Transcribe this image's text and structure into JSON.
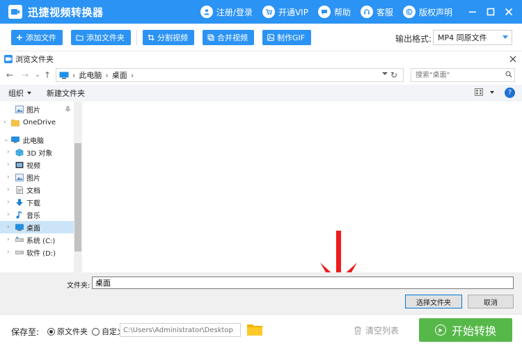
{
  "app": {
    "title": "迅捷视频转换器",
    "links": [
      {
        "label": "注册/登录",
        "icon": "user-icon"
      },
      {
        "label": "开通VIP",
        "icon": "cart-icon"
      },
      {
        "label": "帮助",
        "icon": "chat-icon"
      },
      {
        "label": "客服",
        "icon": "headset-icon"
      },
      {
        "label": "版权声明",
        "icon": "copyright-icon"
      }
    ],
    "accent": "#2b93f3"
  },
  "toolbar": {
    "buttons": [
      {
        "label": "添加文件",
        "icon": "plus-icon"
      },
      {
        "label": "添加文件夹",
        "icon": "folder-plus-icon"
      },
      {
        "label": "分割视频",
        "icon": "crop-icon"
      },
      {
        "label": "合并视频",
        "icon": "merge-icon"
      },
      {
        "label": "制作GIF",
        "icon": "gif-icon"
      }
    ],
    "format_label": "输出格式:",
    "format_value": "MP4  同原文件"
  },
  "dialog": {
    "title": "浏览文件夹",
    "breadcrumb": [
      "此电脑",
      "桌面"
    ],
    "search_placeholder": "搜索\"桌面\"",
    "commands": {
      "organize": "组织",
      "new_folder": "新建文件夹"
    },
    "tree": [
      {
        "label": "图片",
        "icon": "pictures-icon",
        "pinned": true
      },
      {
        "label": "OneDrive",
        "icon": "folder-icon"
      },
      {
        "label": "此电脑",
        "icon": "computer-icon"
      },
      {
        "label": "3D 对象",
        "icon": "cube-icon"
      },
      {
        "label": "视频",
        "icon": "video-icon"
      },
      {
        "label": "图片",
        "icon": "pictures-icon"
      },
      {
        "label": "文档",
        "icon": "document-icon"
      },
      {
        "label": "下载",
        "icon": "download-icon"
      },
      {
        "label": "音乐",
        "icon": "music-icon"
      },
      {
        "label": "桌面",
        "icon": "desktop-icon",
        "selected": true
      },
      {
        "label": "系统 (C:)",
        "icon": "drive-icon"
      },
      {
        "label": "软件 (D:)",
        "icon": "drive-icon"
      }
    ],
    "folder_label": "文件夹:",
    "folder_value": "桌面",
    "select_button": "选择文件夹",
    "cancel_button": "取消"
  },
  "bottom": {
    "save_label": "保存至:",
    "radio_original": "原文件夹",
    "radio_custom": "自定义",
    "path_placeholder": "C:\\Users\\Administrator\\Desktop",
    "clear_label": "清空列表",
    "start_label": "开始转换",
    "start_color": "#57b84a"
  }
}
